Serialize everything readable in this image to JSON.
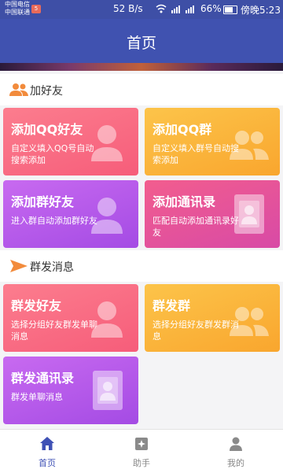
{
  "status_bar": {
    "carrier_1": "中国电信",
    "carrier_2": "中国联通",
    "carrier_badge": "5",
    "network_speed": "52 B/s",
    "battery": "66%",
    "time": "傍晚5:23"
  },
  "header": {
    "title": "首页"
  },
  "sections": {
    "add_friends": {
      "title": "加好友",
      "icon": "people-icon",
      "cards": [
        {
          "title": "添加QQ好友",
          "desc": "自定义填入QQ号自动搜索添加",
          "icon": "person-icon"
        },
        {
          "title": "添加QQ群",
          "desc": "自定义填入群号自动搜索添加",
          "icon": "group-icon"
        },
        {
          "title": "添加群好友",
          "desc": "进入群自动添加群好友",
          "icon": "person-icon"
        },
        {
          "title": "添加通讯录",
          "desc": "匹配自动添加通讯录好友",
          "icon": "contact-card-icon"
        }
      ]
    },
    "broadcast": {
      "title": "群发消息",
      "icon": "send-icon",
      "cards": [
        {
          "title": "群发好友",
          "desc": "选择分组好友群发单聊消息",
          "icon": "person-icon"
        },
        {
          "title": "群发群",
          "desc": "选择分组好友群发群消息",
          "icon": "group-icon"
        },
        {
          "title": "群发通讯录",
          "desc": "群发单聊消息",
          "icon": "contact-card-icon"
        }
      ]
    }
  },
  "bottom_nav": [
    {
      "label": "首页",
      "icon": "home-icon",
      "active": true
    },
    {
      "label": "助手",
      "icon": "assistant-icon",
      "active": false
    },
    {
      "label": "我的",
      "icon": "profile-icon",
      "active": false
    }
  ],
  "colors": {
    "primary": "#4052b0",
    "nav_active": "#3f51b5",
    "nav_inactive": "#888888",
    "card_pink": "#f86a7e",
    "card_orange": "#fbb43a",
    "card_purple": "#b356ea",
    "card_pink_purple": "#e84a8e"
  }
}
